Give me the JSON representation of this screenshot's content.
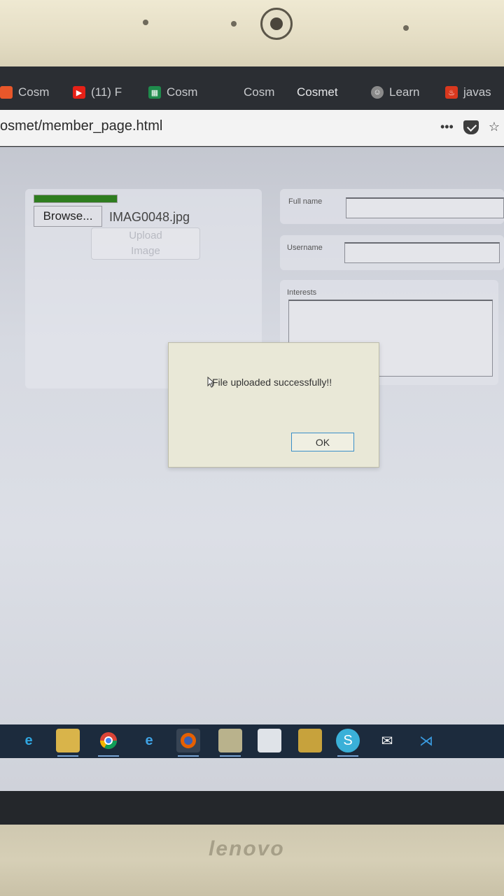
{
  "browser": {
    "tabs": [
      {
        "label": "Cosm",
        "icon": "firefox-icon",
        "color": "#e8572a"
      },
      {
        "label": "(11) F",
        "icon": "youtube-icon",
        "color": "#e62117"
      },
      {
        "label": "Cosm",
        "icon": "spreadsheet-icon",
        "color": "#1f8b4c"
      },
      {
        "label": "Cosm",
        "icon": "",
        "color": ""
      },
      {
        "label": "Cosmet",
        "icon": "",
        "color": ""
      },
      {
        "label": "Learn",
        "icon": "face-icon",
        "color": "#8a8a8a"
      },
      {
        "label": "javas",
        "icon": "java-icon",
        "color": "#d9381e"
      }
    ],
    "url": "osmet/member_page.html",
    "more_icon": "•••"
  },
  "page": {
    "upload": {
      "progress_percent": 100,
      "browse_label": "Browse...",
      "file_name": "IMAG0048.jpg",
      "upload_label_line1": "Upload",
      "upload_label_line2": "Image"
    },
    "form": {
      "fullname_label": "Full name",
      "username_label": "Username",
      "interests_label": "Interests"
    }
  },
  "dialog": {
    "message": "File uploaded successfully!!",
    "ok_label": "OK"
  },
  "taskbar": {
    "icons": [
      "edge-icon",
      "file-explorer-icon",
      "chrome-icon",
      "internet-explorer-icon",
      "firefox-icon",
      "notepad-icon",
      "folder-icon",
      "app-icon",
      "skype-icon",
      "mail-icon",
      "vscode-icon"
    ]
  },
  "laptop": {
    "brand": "lenovo"
  },
  "colors": {
    "progress_fill": "#2e7d1f",
    "ok_border": "#3a8fc8",
    "taskbar": "#1c2b3d"
  }
}
